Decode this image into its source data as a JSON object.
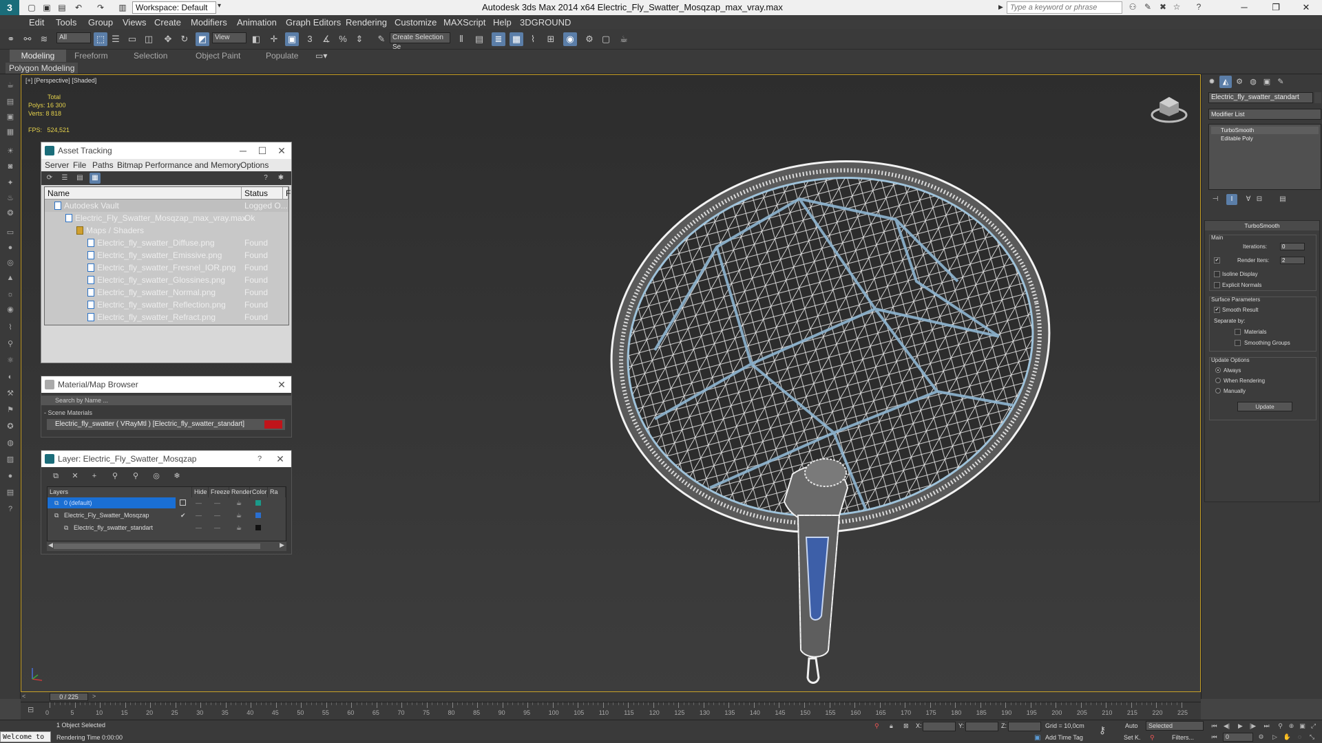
{
  "titlebar": {
    "logo": "3",
    "workspace": "Workspace: Default",
    "title": "Autodesk 3ds Max  2014 x64     Electric_Fly_Swatter_Mosqzap_max_vray.max",
    "search_placeholder": "Type a keyword or phrase",
    "qa_icons": [
      "new-icon",
      "open-icon",
      "save-icon",
      "undo-icon",
      "redo-icon",
      "project-icon"
    ],
    "qa_glyphs": [
      "▢",
      "▣",
      "▤",
      "↶",
      "↷",
      "▥"
    ],
    "win_min": "─",
    "win_max": "❐",
    "win_close": "✕"
  },
  "menu": [
    "Edit",
    "Tools",
    "Group",
    "Views",
    "Create",
    "Modifiers",
    "Animation",
    "Graph Editors",
    "Rendering",
    "Customize",
    "MAXScript",
    "Help",
    "3DGROUND"
  ],
  "toolbar": {
    "filter_value": "All",
    "refcoord_value": "View",
    "named_selection": "Create Selection Se"
  },
  "ribbon": {
    "tabs": [
      "Modeling",
      "Freeform",
      "Selection",
      "Object Paint",
      "Populate"
    ],
    "panel_label": "Polygon Modeling"
  },
  "viewport": {
    "label": "[+] [Perspective] [Shaded]",
    "stats": {
      "total_label": "Total",
      "polys_label": "Polys:",
      "polys_value": "16 300",
      "verts_label": "Verts:",
      "verts_value": "8 818",
      "fps_label": "FPS:",
      "fps_value": "524,521"
    },
    "colors": {
      "wire": "#f2f2f2",
      "accent": "#7fb2d6",
      "handle_insert": "#3d5fa8",
      "stats": "#e5d24b"
    }
  },
  "asset_tracking": {
    "title": "Asset Tracking",
    "menu": [
      "Server",
      "File",
      "Paths",
      "Bitmap Performance and Memory",
      "Options"
    ],
    "columns": [
      "Name",
      "Status",
      "F"
    ],
    "rows": [
      {
        "name": "Autodesk Vault",
        "status": "Logged O..."
      },
      {
        "name": "Electric_Fly_Swatter_Mosqzap_max_vray.max",
        "status": "Ok"
      },
      {
        "name": "Maps / Shaders",
        "status": ""
      },
      {
        "name": "Electric_fly_swatter_Diffuse.png",
        "status": "Found"
      },
      {
        "name": "Electric_fly_swatter_Emissive.png",
        "status": "Found"
      },
      {
        "name": "Electric_fly_swatter_Fresnel_IOR.png",
        "status": "Found"
      },
      {
        "name": "Electric_fly_swatter_Glossines.png",
        "status": "Found"
      },
      {
        "name": "Electric_fly_swatter_Normal.png",
        "status": "Found"
      },
      {
        "name": "Electric_fly_swatter_Reflection.png",
        "status": "Found"
      },
      {
        "name": "Electric_fly_swatter_Refract.png",
        "status": "Found"
      }
    ]
  },
  "material_browser": {
    "title": "Material/Map Browser",
    "search_placeholder": "Search by Name ...",
    "section": "- Scene Materials",
    "material": "Electric_fly_swatter  ( VRayMtl )  [Electric_fly_swatter_standart]",
    "swatch_color": "#c0141a"
  },
  "layer_dialog": {
    "title": "Layer: Electric_Fly_Swatter_Mosqzap",
    "help": "?",
    "columns": [
      "Layers",
      "Hide",
      "Freeze",
      "Render",
      "Color",
      "Ra"
    ],
    "rows": [
      {
        "name": "0 (default)",
        "color": "#1a9a8a"
      },
      {
        "name": "Electric_Fly_Swatter_Mosqzap",
        "color": "#2a6fd0"
      },
      {
        "name": "Electric_fly_swatter_standart",
        "color": "#111111"
      }
    ]
  },
  "command_panel": {
    "object_name": "Electric_fly_swatter_standart",
    "modifier_list": "Modifier List",
    "stack": [
      "TurboSmooth",
      "Editable Poly"
    ],
    "rollout_title": "TurboSmooth",
    "main_label": "Main",
    "iterations_label": "Iterations:",
    "iterations_value": "0",
    "render_iters_label": "Render Iters:",
    "render_iters_value": "2",
    "isoline": "Isoline Display",
    "explicit": "Explicit Normals",
    "surface_label": "Surface Parameters",
    "smooth_result": "Smooth Result",
    "separate_by": "Separate by:",
    "materials": "Materials",
    "smoothing_groups": "Smoothing Groups",
    "update_options": "Update Options",
    "always": "Always",
    "when_rendering": "When Rendering",
    "manually": "Manually",
    "update_btn": "Update"
  },
  "timeline": {
    "slider": "0 / 225",
    "ticks": [
      "0",
      "5",
      "10",
      "15",
      "20",
      "25",
      "30",
      "35",
      "40",
      "45",
      "50",
      "55",
      "60",
      "65",
      "70",
      "75",
      "80",
      "85",
      "90",
      "95",
      "100",
      "105",
      "110",
      "115",
      "120",
      "125",
      "130",
      "135",
      "140",
      "145",
      "150",
      "155",
      "160",
      "165",
      "170",
      "175",
      "180",
      "185",
      "190",
      "195",
      "200",
      "205",
      "210",
      "215",
      "220",
      "225"
    ]
  },
  "status": {
    "maxscript": "Welcome to",
    "selection": "1 Object Selected",
    "render_time": "Rendering Time  0:00:00",
    "x_label": "X:",
    "y_label": "Y:",
    "z_label": "Z:",
    "grid": "Grid = 10,0cm",
    "add_time_tag": "Add Time Tag",
    "auto": "Auto",
    "set_key": "Set K.",
    "selected": "Selected",
    "filters": "Filters...",
    "frame": "0"
  }
}
